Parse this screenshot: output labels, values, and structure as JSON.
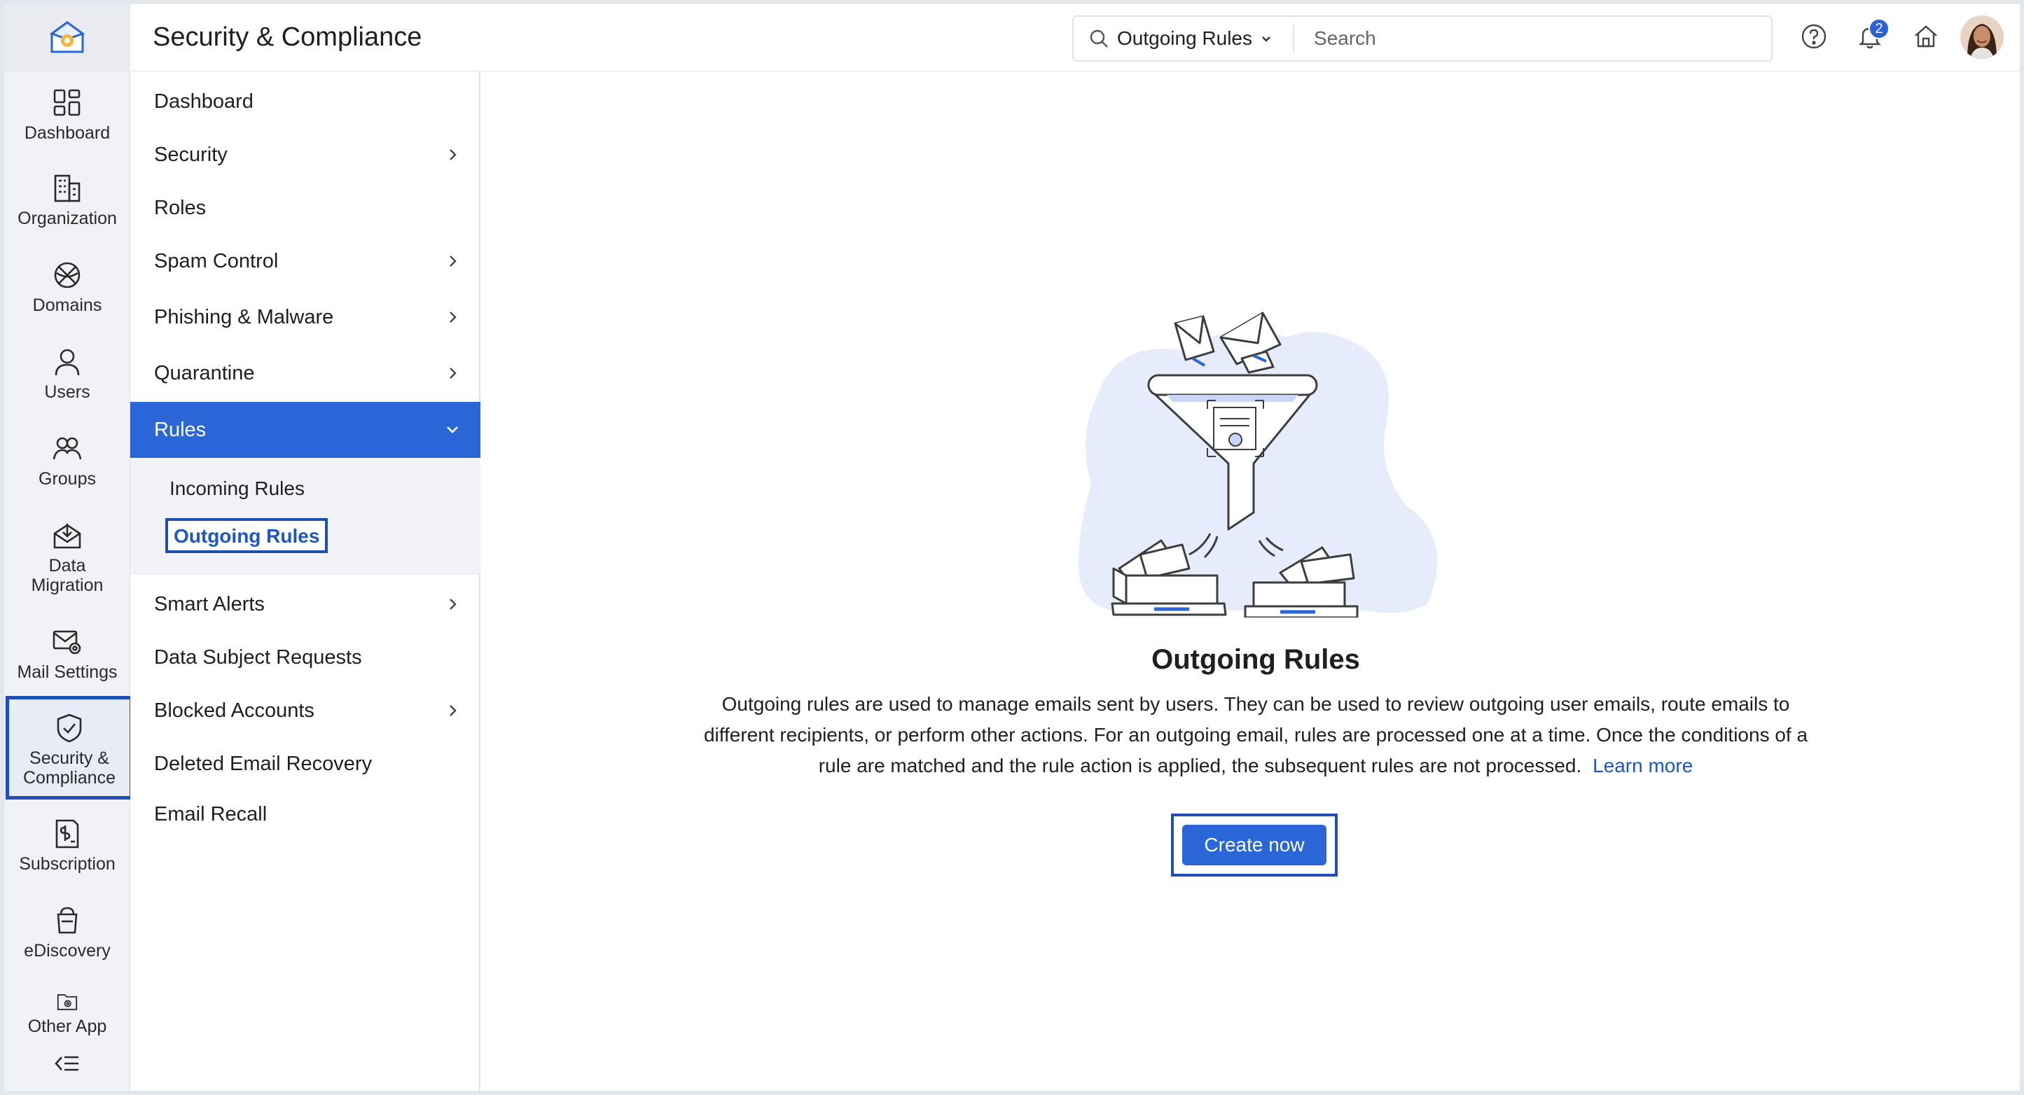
{
  "header": {
    "title": "Security & Compliance",
    "search_scope": "Outgoing Rules",
    "search_placeholder": "Search",
    "notification_count": "2"
  },
  "rail": {
    "items": [
      {
        "label": "Dashboard",
        "icon": "dashboard-icon"
      },
      {
        "label": "Organization",
        "icon": "building-icon"
      },
      {
        "label": "Domains",
        "icon": "globe-icon"
      },
      {
        "label": "Users",
        "icon": "user-icon"
      },
      {
        "label": "Groups",
        "icon": "group-icon"
      },
      {
        "label": "Data\nMigration",
        "icon": "mail-import-icon"
      },
      {
        "label": "Mail Settings",
        "icon": "mail-gear-icon"
      },
      {
        "label": "Security &\nCompliance",
        "icon": "shield-check-icon"
      },
      {
        "label": "Subscription",
        "icon": "subscription-icon"
      },
      {
        "label": "eDiscovery",
        "icon": "discovery-icon"
      },
      {
        "label": "Other App",
        "icon": "folder-gear-icon"
      }
    ],
    "active": "Security & Compliance"
  },
  "nav": {
    "items": [
      {
        "label": "Dashboard",
        "chevron": false
      },
      {
        "label": "Security",
        "chevron": true
      },
      {
        "label": "Roles",
        "chevron": false
      },
      {
        "label": "Spam Control",
        "chevron": true
      },
      {
        "label": "Phishing & Malware",
        "chevron": true
      },
      {
        "label": "Quarantine",
        "chevron": true
      },
      {
        "label": "Rules",
        "chevron": true,
        "expanded": true
      },
      {
        "label": "Smart Alerts",
        "chevron": true
      },
      {
        "label": "Data Subject Requests",
        "chevron": false
      },
      {
        "label": "Blocked Accounts",
        "chevron": true
      },
      {
        "label": "Deleted Email Recovery",
        "chevron": false
      },
      {
        "label": "Email Recall",
        "chevron": false
      }
    ],
    "sub_items": [
      {
        "label": "Incoming Rules"
      },
      {
        "label": "Outgoing Rules",
        "selected": true
      }
    ]
  },
  "main": {
    "title": "Outgoing Rules",
    "description": "Outgoing rules are used to manage emails sent by users. They can be used to review outgoing user emails, route emails to different recipients, or perform other actions. For an outgoing email, rules are processed one at a time. Once the conditions of a rule are matched and the rule action is applied, the subsequent rules are not processed.",
    "learn_more": "Learn more",
    "create_button": "Create now"
  },
  "colors": {
    "accent": "#2b66d9",
    "highlight_border": "#1f4fb3",
    "link": "#1f56c4"
  }
}
